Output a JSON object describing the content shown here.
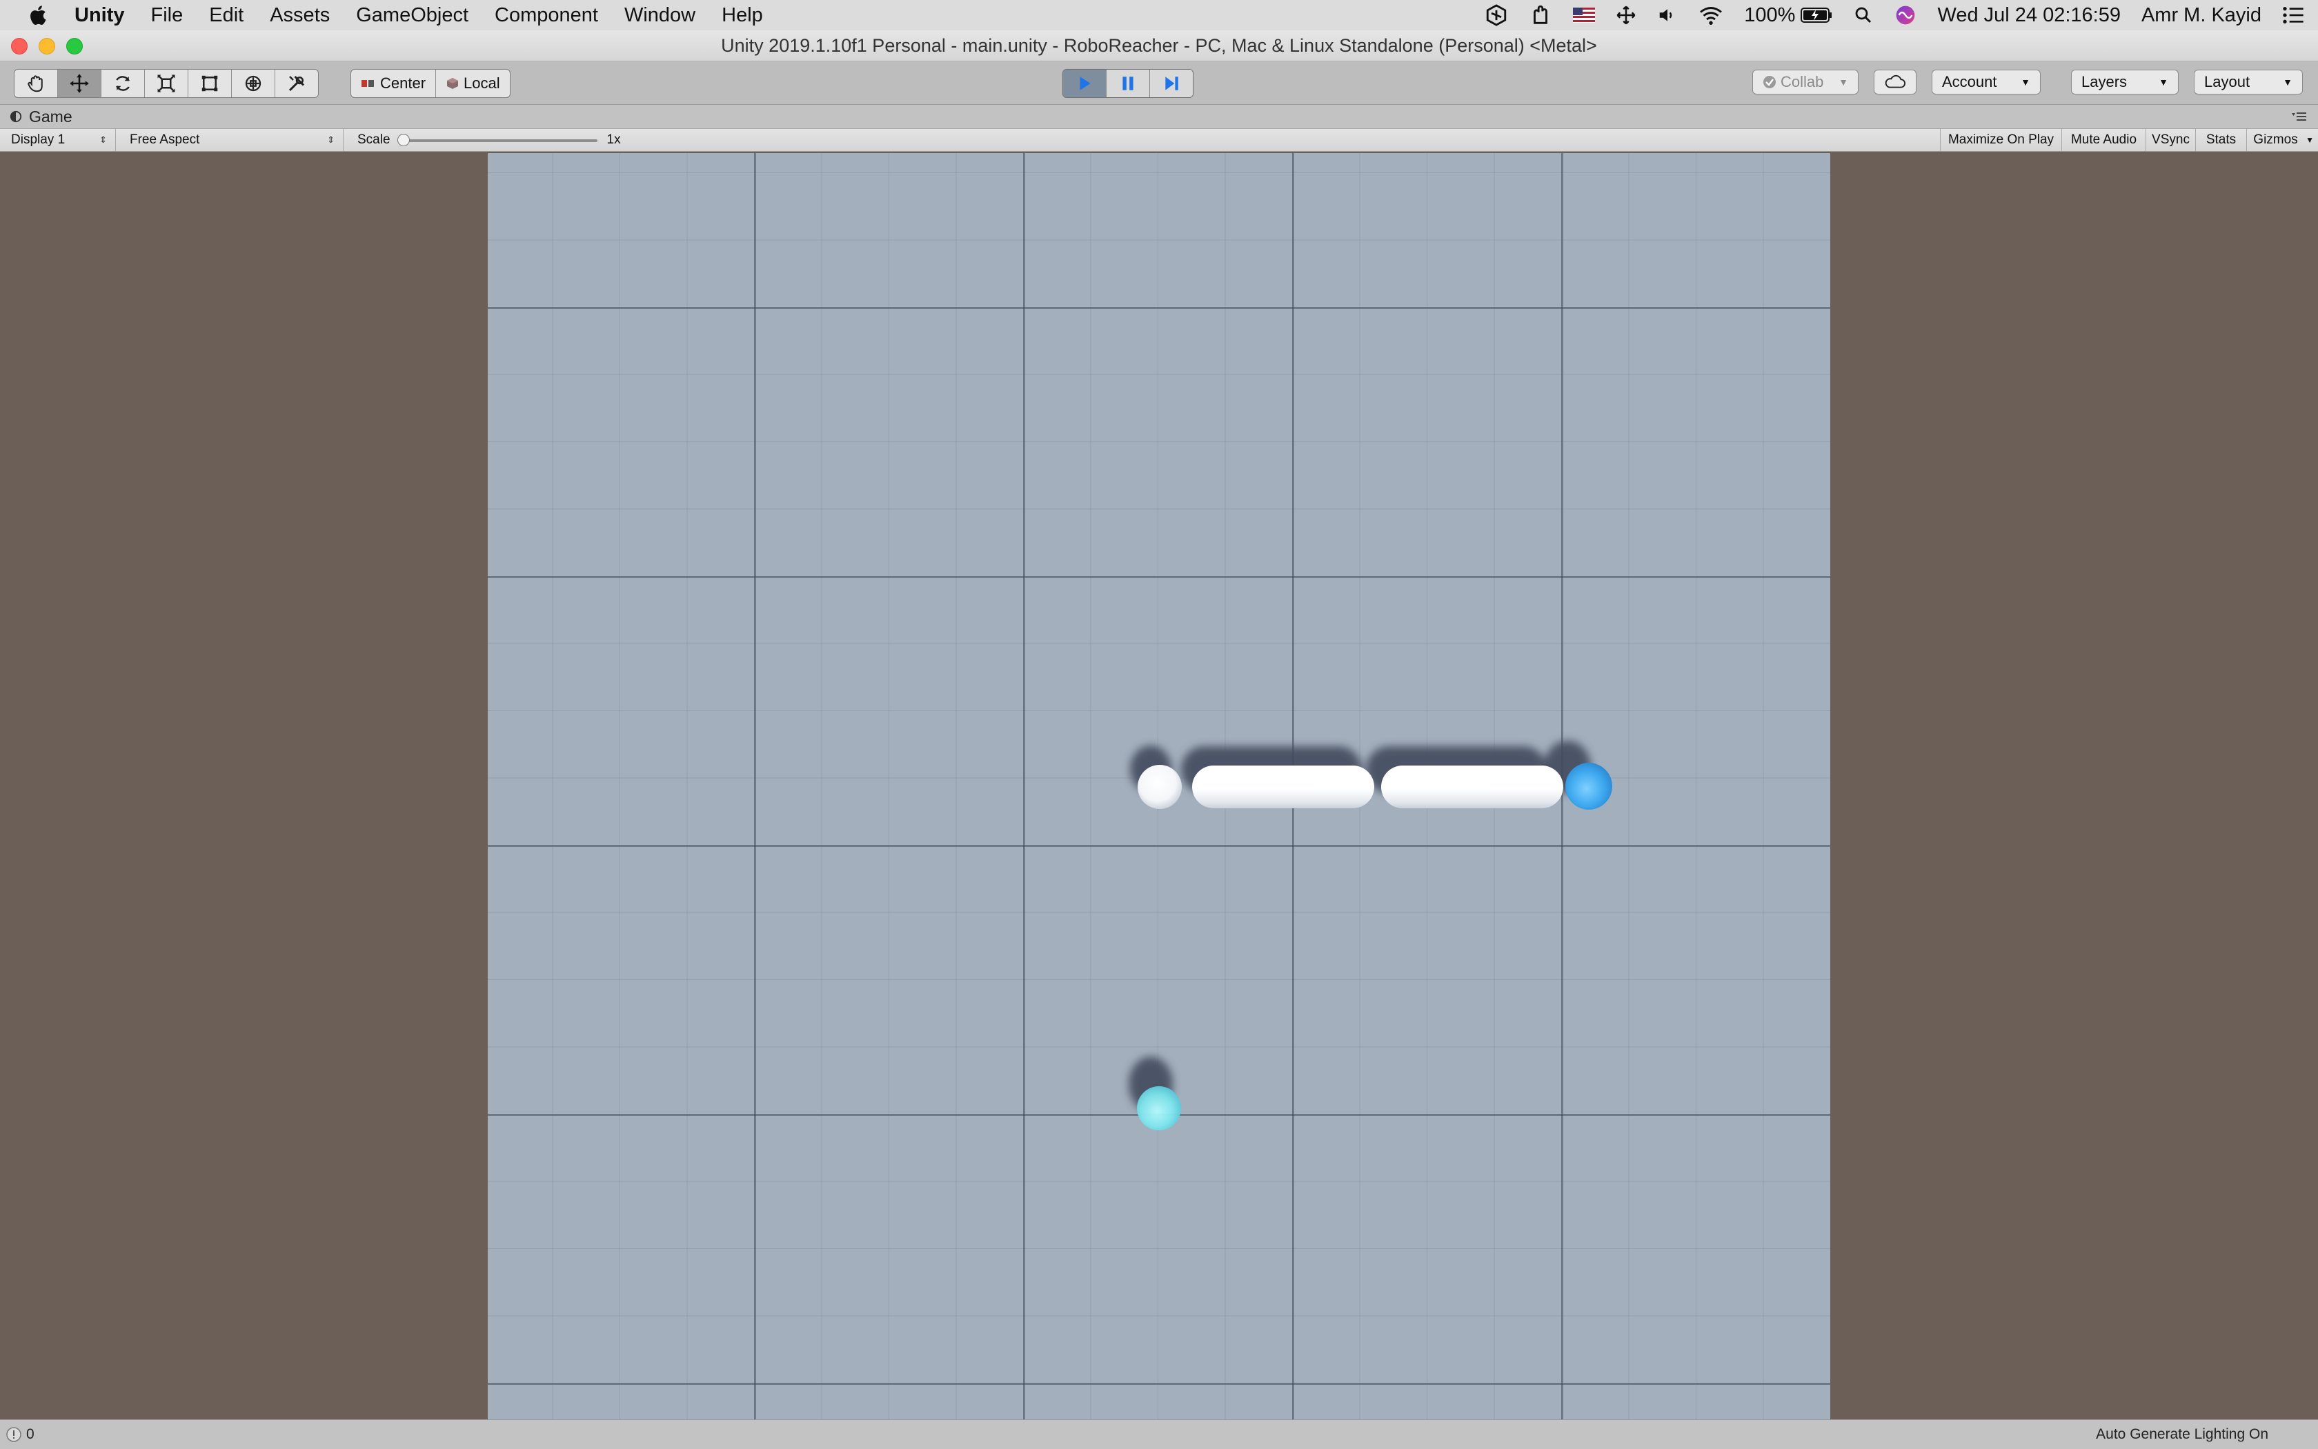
{
  "menubar": {
    "app_name": "Unity",
    "items": [
      "File",
      "Edit",
      "Assets",
      "GameObject",
      "Component",
      "Window",
      "Help"
    ],
    "battery": "100%",
    "clock": "Wed Jul 24  02:16:59",
    "user": "Amr M. Kayid"
  },
  "window": {
    "title": "Unity 2019.1.10f1 Personal - main.unity - RoboReacher - PC, Mac & Linux Standalone (Personal) <Metal>"
  },
  "toolbar": {
    "pivot": "Center",
    "space": "Local",
    "collab": "Collab",
    "account": "Account",
    "layers": "Layers",
    "layout": "Layout"
  },
  "game_tab": {
    "label": "Game"
  },
  "game_bar": {
    "display": "Display 1",
    "aspect": "Free Aspect",
    "scale_label": "Scale",
    "scale_value": "1x",
    "maximize": "Maximize On Play",
    "mute": "Mute Audio",
    "vsync": "VSync",
    "stats": "Stats",
    "gizmos": "Gizmos"
  },
  "status_bar": {
    "count": "0",
    "message": "Auto Generate Lighting On"
  },
  "colors": {
    "floor": "#a4afbd",
    "background": "#6b5f57",
    "effector": "#3fa9f0",
    "target": "#7fe6ee",
    "play_active": "#1e74e8"
  }
}
